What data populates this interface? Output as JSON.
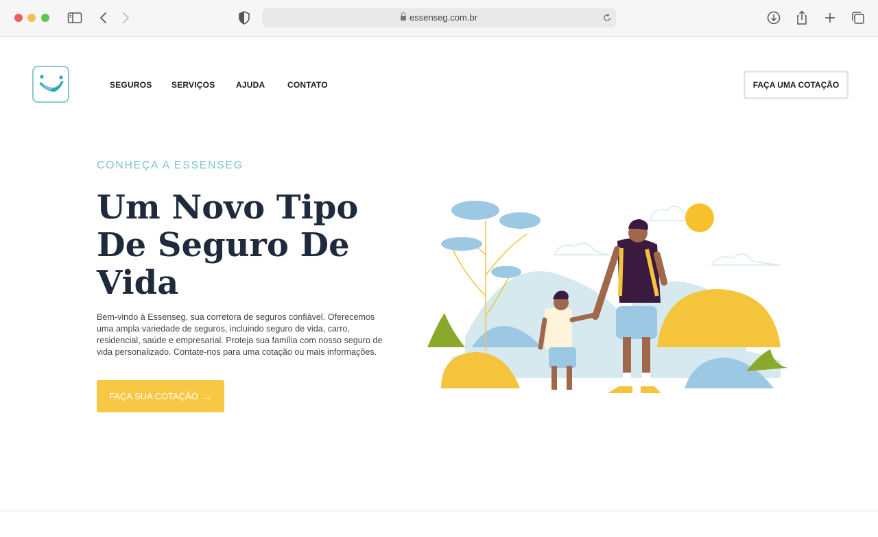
{
  "browser": {
    "url": "essenseg.com.br"
  },
  "nav": {
    "items": [
      "SEGUROS",
      "SERVIÇOS",
      "AJUDA",
      "CONTATO"
    ],
    "cta": "FAÇA UMA COTAÇÃO"
  },
  "hero": {
    "eyebrow": "CONHEÇA A ESSENSEG",
    "title_lines": [
      "Um Novo Tipo",
      "De Seguro De",
      "Vida"
    ],
    "description": "Bem-vindo à Essenseg, sua corretora de seguros confiável. Oferecemos uma ampla variedade de seguros, incluindo seguro de vida, carro, residencial, saúde e empresarial. Proteja sua família com nosso seguro de vida personalizado. Contate-nos para uma cotação ou mais informações.",
    "button_label": "FAÇA SUA COTAÇÃO",
    "button_arrow": "→"
  },
  "colors": {
    "accent_teal": "#7cc6d1",
    "accent_yellow": "#f7c843",
    "title_navy": "#1f2a3d"
  }
}
